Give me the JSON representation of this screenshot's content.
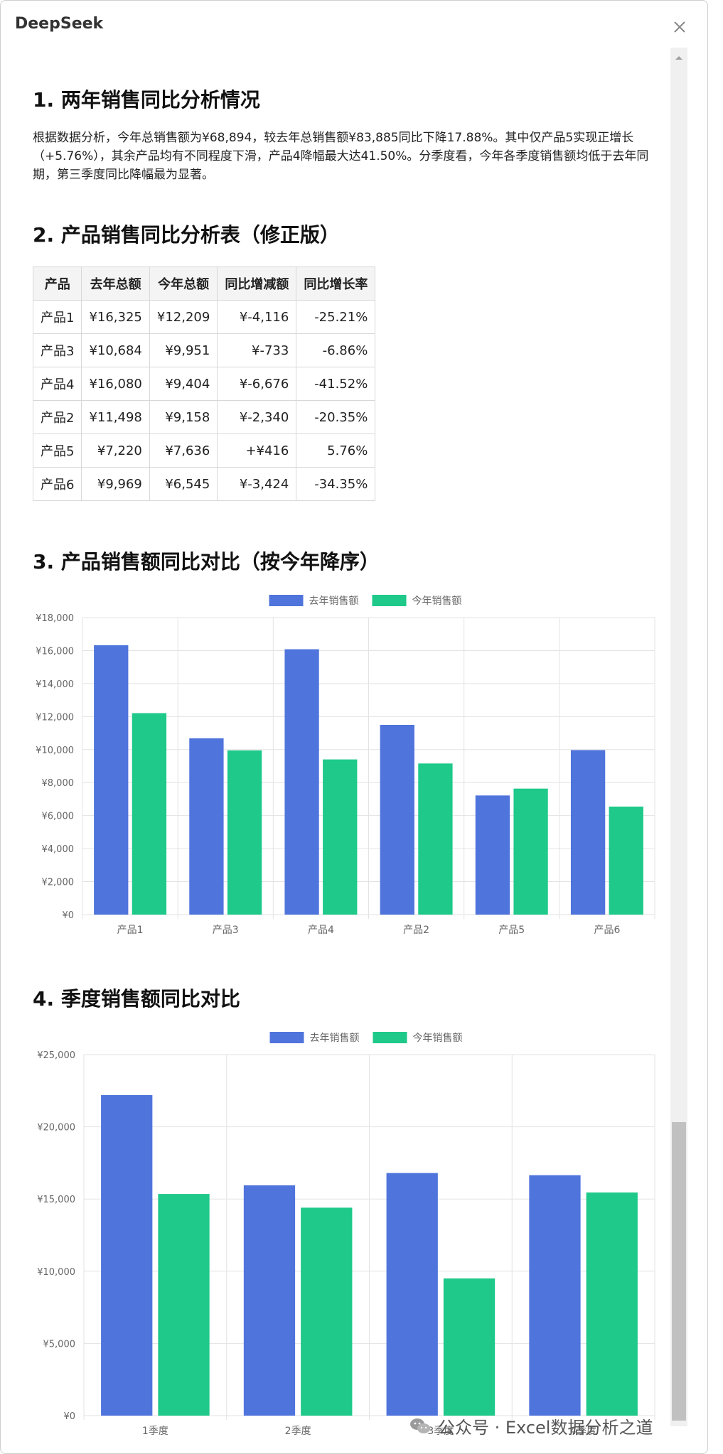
{
  "app": {
    "title": "DeepSeek"
  },
  "sections": {
    "s1": {
      "title": "1. 两年销售同比分析情况",
      "paragraph": "根据数据分析，今年总销售额为¥68,894，较去年总销售额¥83,885同比下降17.88%。其中仅产品5实现正增长（+5.76%），其余产品均有不同程度下滑，产品4降幅最大达41.50%。分季度看，今年各季度销售额均低于去年同期，第三季度同比降幅最为显著。"
    },
    "s2": {
      "title": "2. 产品销售同比分析表（修正版）",
      "headers": [
        "产品",
        "去年总额",
        "今年总额",
        "同比增减额",
        "同比增长率"
      ],
      "rows": [
        [
          "产品1",
          "¥16,325",
          "¥12,209",
          "¥-4,116",
          "-25.21%"
        ],
        [
          "产品3",
          "¥10,684",
          "¥9,951",
          "¥-733",
          "-6.86%"
        ],
        [
          "产品4",
          "¥16,080",
          "¥9,404",
          "¥-6,676",
          "-41.52%"
        ],
        [
          "产品2",
          "¥11,498",
          "¥9,158",
          "¥-2,340",
          "-20.35%"
        ],
        [
          "产品5",
          "¥7,220",
          "¥7,636",
          "+¥416",
          "5.76%"
        ],
        [
          "产品6",
          "¥9,969",
          "¥6,545",
          "¥-3,424",
          "-34.35%"
        ]
      ]
    },
    "s3": {
      "title": "3. 产品销售额同比对比（按今年降序）"
    },
    "s4": {
      "title": "4. 季度销售额同比对比"
    }
  },
  "watermark": {
    "text": "公众号 · Excel数据分析之道",
    "icon": "wechat-icon"
  },
  "colors": {
    "last_year": "#4f74dc",
    "this_year": "#1ec98a",
    "grid": "#e3e3e3"
  },
  "chart_data": [
    {
      "type": "bar",
      "categories": [
        "产品1",
        "产品3",
        "产品4",
        "产品2",
        "产品5",
        "产品6"
      ],
      "series": [
        {
          "name": "去年销售额",
          "values": [
            16325,
            10684,
            16080,
            11498,
            7220,
            9969
          ]
        },
        {
          "name": "今年销售额",
          "values": [
            12209,
            9951,
            9404,
            9158,
            7636,
            6545
          ]
        }
      ],
      "ylim": [
        0,
        18000
      ],
      "yticks": [
        "¥0",
        "¥2,000",
        "¥4,000",
        "¥6,000",
        "¥8,000",
        "¥10,000",
        "¥12,000",
        "¥14,000",
        "¥16,000",
        "¥18,000"
      ],
      "legend": "top-center",
      "grid": true
    },
    {
      "type": "bar",
      "categories": [
        "1季度",
        "2季度",
        "3季度",
        "4季度"
      ],
      "series": [
        {
          "name": "去年销售额",
          "values": [
            22200,
            15950,
            16800,
            16650
          ]
        },
        {
          "name": "今年销售额",
          "values": [
            15350,
            14400,
            9500,
            15450
          ]
        }
      ],
      "ylim": [
        0,
        25000
      ],
      "yticks": [
        "¥0",
        "¥5,000",
        "¥10,000",
        "¥15,000",
        "¥20,000",
        "¥25,000"
      ],
      "legend": "top-center",
      "grid": true
    }
  ]
}
